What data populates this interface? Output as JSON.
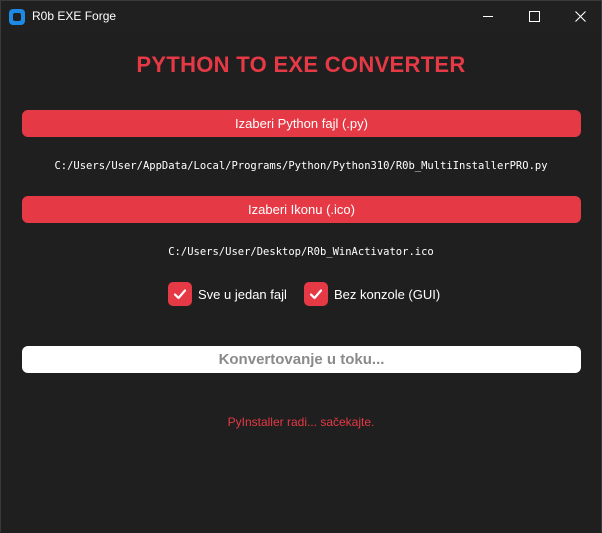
{
  "window": {
    "title": "R0b EXE Forge",
    "controls": [
      "minimize-icon",
      "maximize-icon",
      "close-icon"
    ]
  },
  "main": {
    "heading": "PYTHON TO EXE CONVERTER",
    "select_python_label": "Izaberi Python fajl (.py)",
    "python_path": "C:/Users/User/AppData/Local/Programs/Python/Python310/R0b_MultiInstallerPRO.py",
    "select_icon_label": "Izaberi Ikonu (.ico)",
    "icon_path": "C:/Users/User/Desktop/R0b_WinActivator.ico",
    "options": [
      {
        "label": "Sve u jedan fajl",
        "checked": true
      },
      {
        "label": "Bez konzole (GUI)",
        "checked": true
      }
    ],
    "convert_label": "Konvertovanje u toku...",
    "status": "PyInstaller radi... sačekajte."
  },
  "colors": {
    "accent": "#e63946",
    "background": "#1f1f1f",
    "titlebar": "#202020"
  }
}
